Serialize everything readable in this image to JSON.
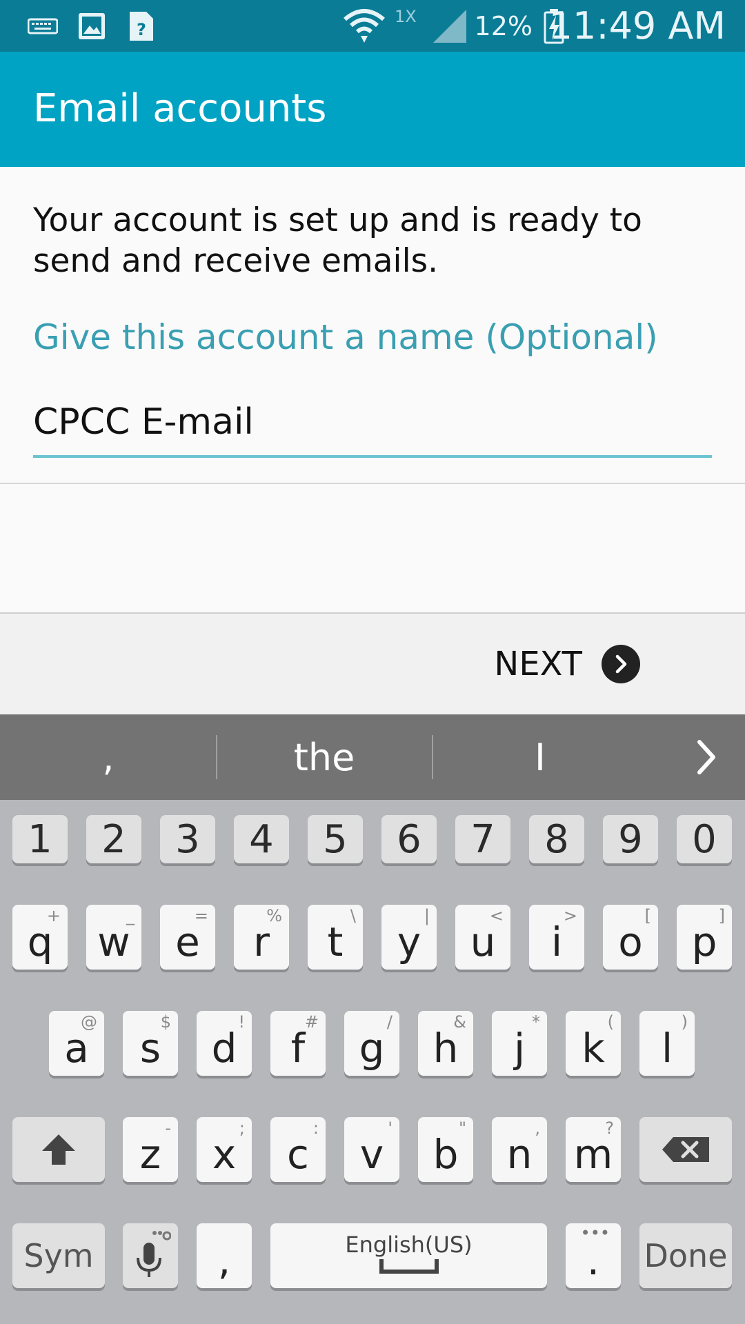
{
  "status_bar": {
    "time": "11:49 AM",
    "battery_percent": "12%",
    "network_type": "1X",
    "icons": [
      "keyboard-icon",
      "image-icon",
      "unknown-file-icon",
      "wifi-icon",
      "signal-icon",
      "battery-charging-icon"
    ]
  },
  "app_bar": {
    "title": "Email accounts"
  },
  "content": {
    "message": "Your account is set up and is ready to send and receive emails.",
    "field_label": "Give this account a name (Optional)",
    "field_value": "CPCC E-mail"
  },
  "buttons": {
    "next_label": "NEXT"
  },
  "suggestions": [
    ",",
    "the",
    "I"
  ],
  "keyboard": {
    "number_row": [
      "1",
      "2",
      "3",
      "4",
      "5",
      "6",
      "7",
      "8",
      "9",
      "0"
    ],
    "row1": [
      {
        "key": "q",
        "sub": "+"
      },
      {
        "key": "w",
        "sub": "_"
      },
      {
        "key": "e",
        "sub": "="
      },
      {
        "key": "r",
        "sub": "%"
      },
      {
        "key": "t",
        "sub": "\\"
      },
      {
        "key": "y",
        "sub": "|"
      },
      {
        "key": "u",
        "sub": "<"
      },
      {
        "key": "i",
        "sub": ">"
      },
      {
        "key": "o",
        "sub": "["
      },
      {
        "key": "p",
        "sub": "]"
      }
    ],
    "row2": [
      {
        "key": "a",
        "sub": "@"
      },
      {
        "key": "s",
        "sub": "$"
      },
      {
        "key": "d",
        "sub": "!"
      },
      {
        "key": "f",
        "sub": "#"
      },
      {
        "key": "g",
        "sub": "/"
      },
      {
        "key": "h",
        "sub": "&"
      },
      {
        "key": "j",
        "sub": "*"
      },
      {
        "key": "k",
        "sub": "("
      },
      {
        "key": "l",
        "sub": ")"
      }
    ],
    "row3": [
      {
        "key": "z",
        "sub": "-"
      },
      {
        "key": "x",
        "sub": ";"
      },
      {
        "key": "c",
        "sub": ":"
      },
      {
        "key": "v",
        "sub": "'"
      },
      {
        "key": "b",
        "sub": "\""
      },
      {
        "key": "n",
        "sub": ","
      },
      {
        "key": "m",
        "sub": "?"
      }
    ],
    "sym_label": "Sym",
    "comma_label": ",",
    "space_label": "English(US)",
    "period_label": ".",
    "period_sub": "•••",
    "done_label": "Done"
  },
  "colors": {
    "status_bar": "#0a7c96",
    "app_bar": "#00a3c4",
    "accent_label": "#3a9fb2",
    "underline": "#6cc3d1",
    "keyboard_bg": "#b6b7bb",
    "suggest_bg": "#737373"
  }
}
